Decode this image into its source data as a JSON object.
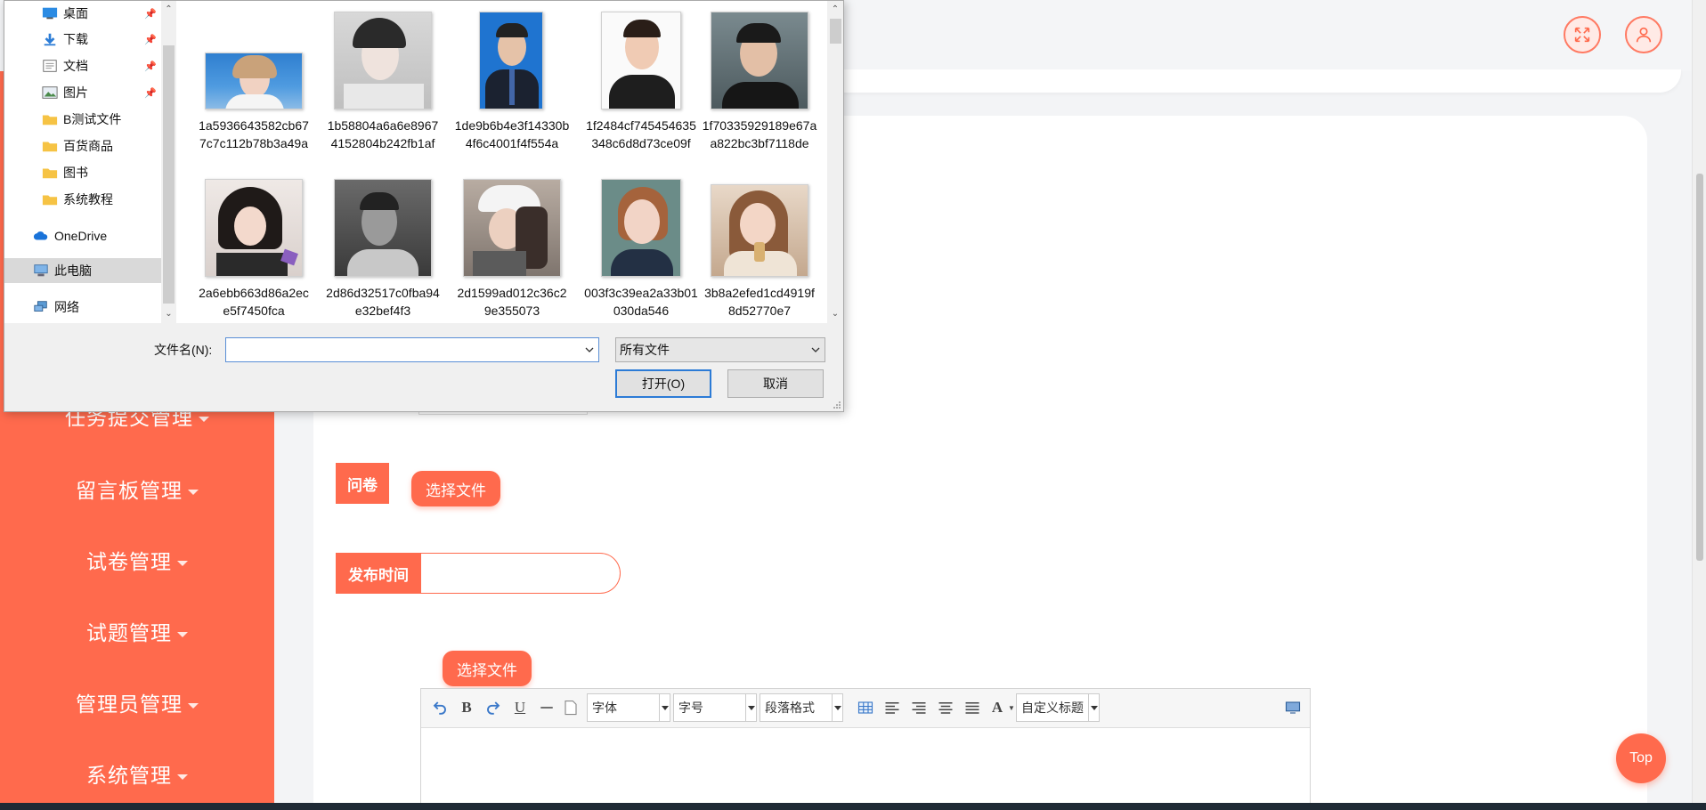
{
  "header": {
    "fullscreen_icon": "fullscreen-icon",
    "user_icon": "user-icon"
  },
  "sidebar": {
    "items": [
      {
        "label": "任务提交管理"
      },
      {
        "label": "留言板管理"
      },
      {
        "label": "试卷管理"
      },
      {
        "label": "试题管理"
      },
      {
        "label": "管理员管理"
      },
      {
        "label": "系统管理"
      }
    ]
  },
  "form": {
    "questionnaire_label": "问卷",
    "questionnaire_upload": "选择文件",
    "publish_time_label": "发布时间",
    "publish_time_value": "",
    "content_upload": "选择文件"
  },
  "editor": {
    "font_select": "字体",
    "size_select": "字号",
    "paragraph_select": "段落格式",
    "custom_title_select": "自定义标题"
  },
  "top_button": "Top",
  "file_dialog": {
    "nav": [
      {
        "label": "桌面",
        "icon": "desktop-icon",
        "pinned": true
      },
      {
        "label": "下载",
        "icon": "download-icon",
        "pinned": true
      },
      {
        "label": "文档",
        "icon": "document-icon",
        "pinned": true
      },
      {
        "label": "图片",
        "icon": "picture-icon",
        "pinned": true
      },
      {
        "label": "B测试文件",
        "icon": "folder-icon",
        "pinned": false
      },
      {
        "label": "百货商品",
        "icon": "folder-icon",
        "pinned": false
      },
      {
        "label": "图书",
        "icon": "folder-icon",
        "pinned": false
      },
      {
        "label": "系统教程",
        "icon": "folder-icon",
        "pinned": false
      },
      {
        "label": "OneDrive",
        "icon": "cloud-icon",
        "pinned": false
      },
      {
        "label": "此电脑",
        "icon": "computer-icon",
        "pinned": false,
        "selected": true
      },
      {
        "label": "网络",
        "icon": "network-icon",
        "pinned": false
      }
    ],
    "files": [
      {
        "name": "1a5936643582cb677c7c112b78b3a49a"
      },
      {
        "name": "1b58804a6a6e89674152804b242fb1af"
      },
      {
        "name": "1de9b6b4e3f14330b4f6c4001f4f554a"
      },
      {
        "name": "1f2484cf745454635348c6d8d73ce09f"
      },
      {
        "name": "1f70335929189e67aa822bc3bf7118de"
      },
      {
        "name": "2a6ebb663d86a2ece5f7450fca"
      },
      {
        "name": "2d86d32517c0fba94e32bef4f3"
      },
      {
        "name": "2d1599ad012c36c29e355073"
      },
      {
        "name": "003f3c39ea2a33b01030da546"
      },
      {
        "name": "3b8a2efed1cd4919f8d52770e7"
      }
    ],
    "filename_label": "文件名(N):",
    "filename_value": "",
    "filter_value": "所有文件",
    "open_button": "打开(O)",
    "cancel_button": "取消"
  },
  "colors": {
    "accent": "#ff6a4d",
    "background": "#f3f4f6",
    "dialog_bg": "#f0f0f0",
    "focus_blue": "#2c7bd6"
  }
}
